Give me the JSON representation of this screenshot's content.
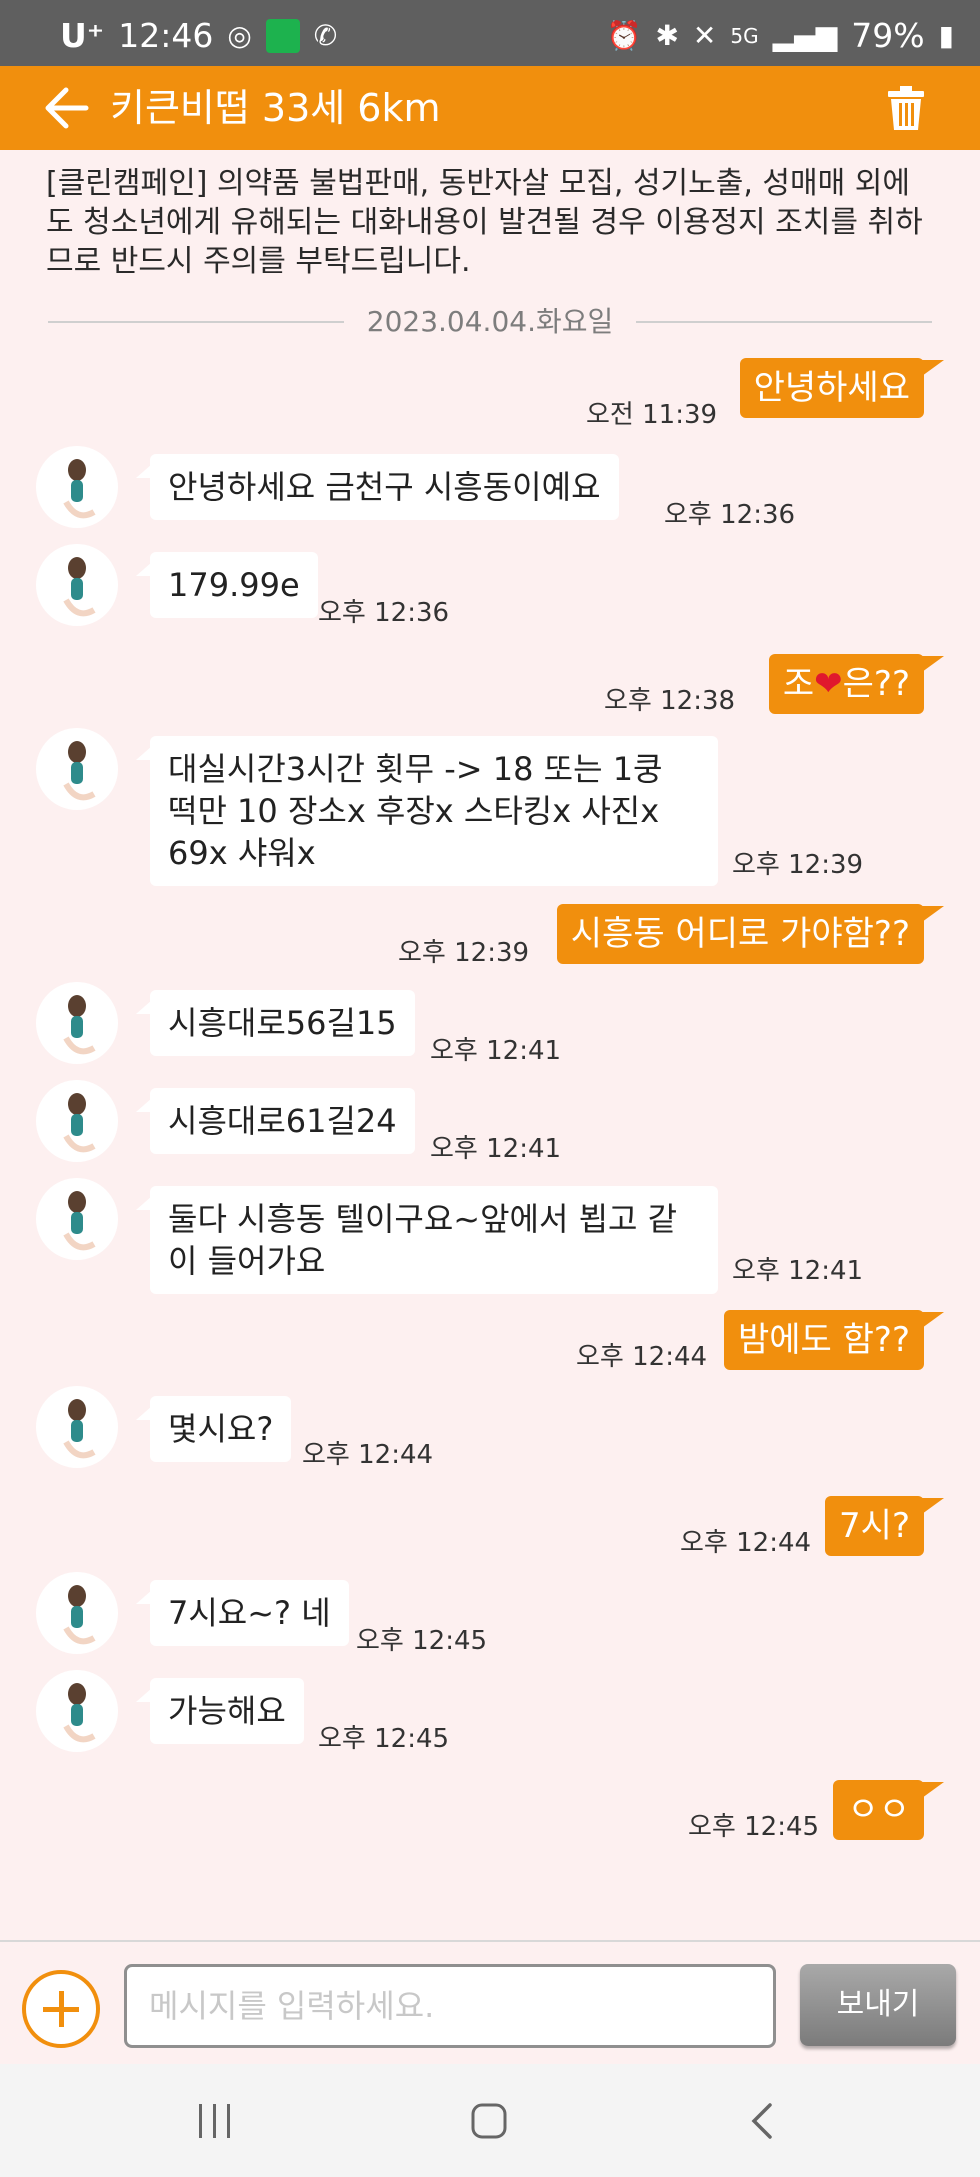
{
  "status": {
    "carrier": "U⁺",
    "time": "12:46",
    "battery": "79%",
    "icons": [
      "vpn-icon",
      "app-icon",
      "wifi-call-icon",
      "alarm-icon",
      "bluetooth-icon",
      "mute-icon",
      "5g-icon",
      "signal-icon",
      "battery-icon"
    ]
  },
  "header": {
    "title": "키큰비떱 33세 6km",
    "accent": "#f18f0d"
  },
  "notice": "[클린캠페인] 의약품 불법판매, 동반자살 모집, 성기노출, 성매매 외에도 청소년에게 유해되는 대화내용이 발견될 경우 이용정지 조치를 취하므로 반드시 주의를 부탁드립니다.",
  "date": "2023.04.04.화요일",
  "messages": [
    {
      "dir": "out",
      "text": "안녕하세요",
      "time": "오전 11:39"
    },
    {
      "dir": "in",
      "text": "안녕하세요 금천구 시흥동이예요",
      "time": "오후 12:36"
    },
    {
      "dir": "in",
      "text": "179.99e",
      "time": "오후 12:36"
    },
    {
      "dir": "out",
      "text_a": "조",
      "text_b": "은??",
      "time": "오후 12:38"
    },
    {
      "dir": "in",
      "line1": "대실시간3시간 횟무 -> 18 또는 1쿵",
      "line2": "떡만 10  장소x 후장x 스타킹x 사진x",
      "line3": "69x 샤워x",
      "time": "오후 12:39"
    },
    {
      "dir": "out",
      "text": "시흥동 어디로 가야함??",
      "time": "오후 12:39"
    },
    {
      "dir": "in",
      "text": "시흥대로56길15",
      "time": "오후 12:41"
    },
    {
      "dir": "in",
      "text": "시흥대로61길24",
      "time": "오후 12:41"
    },
    {
      "dir": "in",
      "line1": "둘다 시흥동 텔이구요~앞에서 뵙고 같",
      "line2": "이 들어가요",
      "time": "오후 12:41"
    },
    {
      "dir": "out",
      "text": "밤에도 함??",
      "time": "오후 12:44"
    },
    {
      "dir": "in",
      "text": "몇시요?",
      "time": "오후 12:44"
    },
    {
      "dir": "out",
      "text": "7시?",
      "time": "오후 12:44"
    },
    {
      "dir": "in",
      "text": "7시요~? 네",
      "time": "오후 12:45"
    },
    {
      "dir": "in",
      "text": "가능해요",
      "time": "오후 12:45"
    },
    {
      "dir": "out",
      "text": "ㅇㅇ",
      "time": "오후 12:45"
    }
  ],
  "composer": {
    "placeholder": "메시지를 입력하세요.",
    "send": "보내기"
  }
}
